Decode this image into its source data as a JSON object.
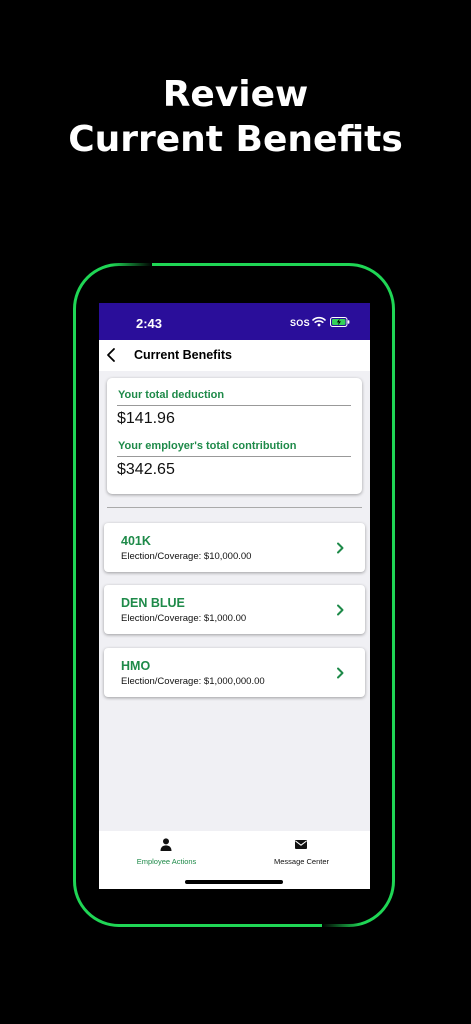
{
  "hero": {
    "line1": "Review",
    "line2": "Current Benefits"
  },
  "status_bar": {
    "time": "2:43",
    "sos": "SOS",
    "background": "#2a0e9a"
  },
  "nav": {
    "title": "Current Benefits",
    "back_icon": "chevron-left-icon"
  },
  "summary": {
    "deduction_label": "Your total deduction",
    "deduction_value": "$141.96",
    "contribution_label": "Your employer's total contribution",
    "contribution_value": "$342.65"
  },
  "benefits": [
    {
      "name": "401K",
      "coverage": "Election/Coverage: $10,000.00"
    },
    {
      "name": "DEN BLUE",
      "coverage": "Election/Coverage: $1,000.00"
    },
    {
      "name": "HMO",
      "coverage": "Election/Coverage: $1,000,000.00"
    }
  ],
  "tabs": [
    {
      "label": "Employee Actions",
      "icon": "person-icon",
      "active": true
    },
    {
      "label": "Message Center",
      "icon": "envelope-icon",
      "active": false
    }
  ],
  "colors": {
    "accent": "#1e8a49",
    "frame": "#1fd655",
    "background": "#000000"
  }
}
